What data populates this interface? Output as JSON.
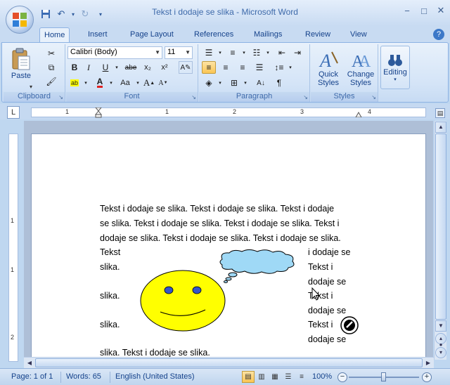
{
  "window": {
    "title": "Tekst i dodaje se slika - Microsoft Word",
    "controls": [
      "minimize",
      "maximize",
      "close"
    ]
  },
  "quick_access": [
    "save-icon",
    "undo-icon",
    "redo-icon",
    "customize-icon"
  ],
  "tabs": [
    "Home",
    "Insert",
    "Page Layout",
    "References",
    "Mailings",
    "Review",
    "View"
  ],
  "active_tab": "Home",
  "ribbon": {
    "clipboard": {
      "label": "Clipboard",
      "paste": "Paste"
    },
    "font": {
      "label": "Font",
      "font_name": "Calibri (Body)",
      "font_size": "11"
    },
    "paragraph": {
      "label": "Paragraph"
    },
    "styles": {
      "label": "Styles",
      "quick_styles": "Quick Styles",
      "change_styles": "Change Styles"
    },
    "editing": {
      "label": "Editing"
    }
  },
  "ruler": {
    "h_numbers": [
      "1",
      "1",
      "2",
      "3",
      "4"
    ],
    "v_numbers": [
      "1",
      "1",
      "2"
    ]
  },
  "document": {
    "lines": [
      "Tekst i dodaje se slika. Tekst i dodaje se slika. Tekst i dodaje",
      "se slika. Tekst i dodaje se slika. Tekst i dodaje se slika. Tekst i",
      "dodaje se slika. Tekst i dodaje se slika. Tekst i dodaje se slika."
    ],
    "left_col": [
      "Tekst",
      "slika.",
      "slika.",
      "slika."
    ],
    "right_col": [
      "i dodaje se",
      "Tekst i",
      "dodaje se",
      "Tekst i",
      "dodaje se",
      "Tekst i",
      "dodaje se"
    ],
    "last_line": "slika. Tekst i dodaje se slika."
  },
  "status": {
    "page": "Page: 1 of 1",
    "words": "Words: 65",
    "language": "English (United States)",
    "zoom": "100%"
  },
  "colors": {
    "smiley_face": "#ffff00",
    "smiley_eyes": "#3355cc",
    "thought_bubble": "#9fd9f6"
  }
}
